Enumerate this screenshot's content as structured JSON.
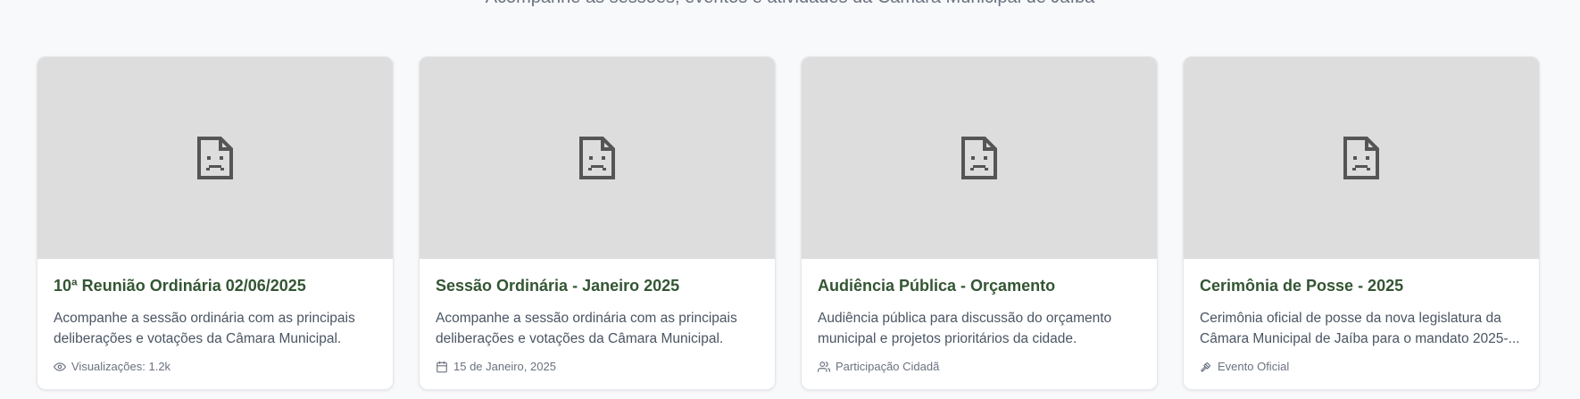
{
  "header": {
    "subtitle": "Acompanhe as sessões, eventos e atividades da Câmara Municipal de Jaíba"
  },
  "cards": [
    {
      "title": "10ª Reunião Ordinária 02/06/2025",
      "description": "Acompanhe a sessão ordinária com as principais deliberações e votações da Câmara Municipal.",
      "meta_icon": "eye-icon",
      "meta": "Visualizações: 1.2k"
    },
    {
      "title": "Sessão Ordinária - Janeiro 2025",
      "description": "Acompanhe a sessão ordinária com as principais deliberações e votações da Câmara Municipal.",
      "meta_icon": "calendar-icon",
      "meta": "15 de Janeiro, 2025"
    },
    {
      "title": "Audiência Pública - Orçamento",
      "description": "Audiência pública para discussão do orçamento municipal e projetos prioritários da cidade.",
      "meta_icon": "users-icon",
      "meta": "Participação Cidadã"
    },
    {
      "title": "Cerimônia de Posse - 2025",
      "description": "Cerimônia oficial de posse da nova legislatura da Câmara Municipal de Jaíba para o mandato 2025-...",
      "meta_icon": "gavel-icon",
      "meta": "Evento Oficial"
    }
  ],
  "colors": {
    "background": "#f8f9fb",
    "title": "#335533",
    "placeholder": "#dddddd"
  }
}
